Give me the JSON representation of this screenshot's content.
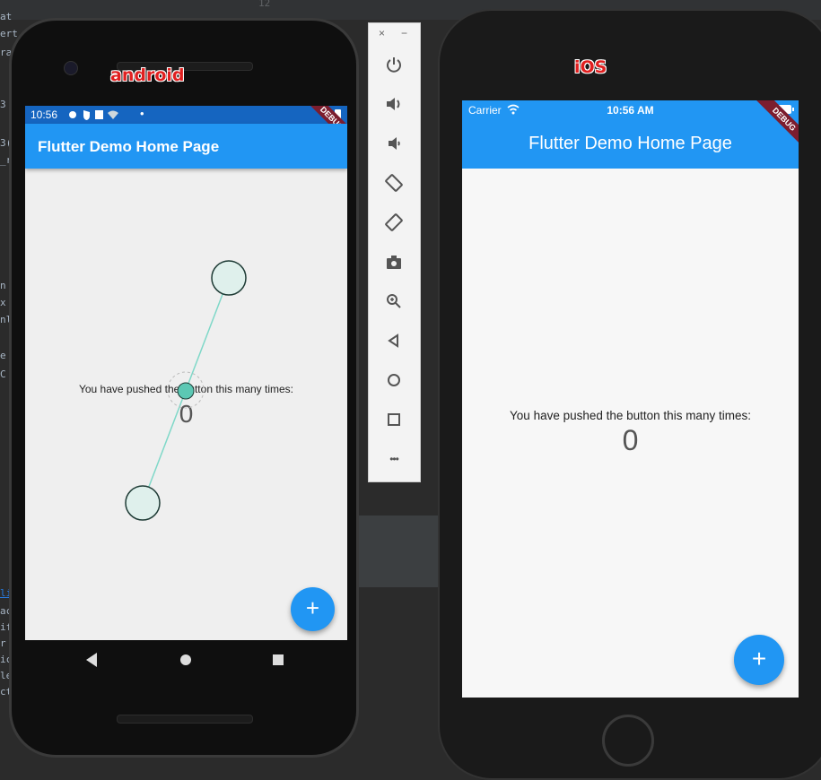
{
  "ide": {
    "line_number": "12",
    "gutter_fragments": [
      "at",
      "ert",
      "ra",
      "3",
      "3(",
      "_r",
      "n",
      "x",
      "nl",
      "e",
      "C",
      "li",
      "ac",
      "if",
      "r",
      "ic",
      "le",
      "ct"
    ]
  },
  "android": {
    "label": "android",
    "status_time": "10:56",
    "debug_banner": "DEBUG",
    "app_title": "Flutter Demo Home Page",
    "body_text": "You have pushed the button this many times:",
    "counter": "0",
    "fab_icon": "+",
    "accent_color": "#2196f3"
  },
  "toolbar": {
    "close": "×",
    "minimize": "−",
    "more": "•••"
  },
  "ios": {
    "label": "iOS",
    "carrier": "Carrier",
    "status_time": "10:56 AM",
    "debug_banner": "DEBUG",
    "app_title": "Flutter Demo Home Page",
    "body_text": "You have pushed the button this many times:",
    "counter": "0",
    "fab_icon": "+",
    "accent_color": "#2196f3"
  }
}
